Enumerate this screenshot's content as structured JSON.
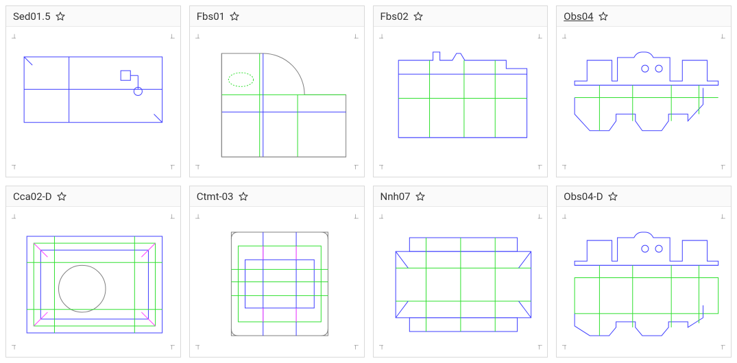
{
  "items": [
    {
      "id": "sed015",
      "label": "Sed01.5",
      "favorite": false,
      "linked": false,
      "shape": "sed015"
    },
    {
      "id": "fbs01",
      "label": "Fbs01",
      "favorite": false,
      "linked": false,
      "shape": "fbs01"
    },
    {
      "id": "fbs02",
      "label": "Fbs02",
      "favorite": false,
      "linked": false,
      "shape": "fbs02"
    },
    {
      "id": "obs04",
      "label": "Obs04",
      "favorite": false,
      "linked": true,
      "shape": "obs04"
    },
    {
      "id": "cca02d",
      "label": "Cca02-D",
      "favorite": false,
      "linked": false,
      "shape": "cca02d"
    },
    {
      "id": "ctmt03",
      "label": "Ctmt-03",
      "favorite": false,
      "linked": false,
      "shape": "ctmt03"
    },
    {
      "id": "nnh07",
      "label": "Nnh07",
      "favorite": false,
      "linked": false,
      "shape": "nnh07"
    },
    {
      "id": "obs04d",
      "label": "Obs04-D",
      "favorite": false,
      "linked": false,
      "shape": "obs04d"
    }
  ],
  "colors": {
    "cut": "#4040ff",
    "crease": "#30e030",
    "aux": "#808080",
    "mark": "#ff40ff"
  }
}
